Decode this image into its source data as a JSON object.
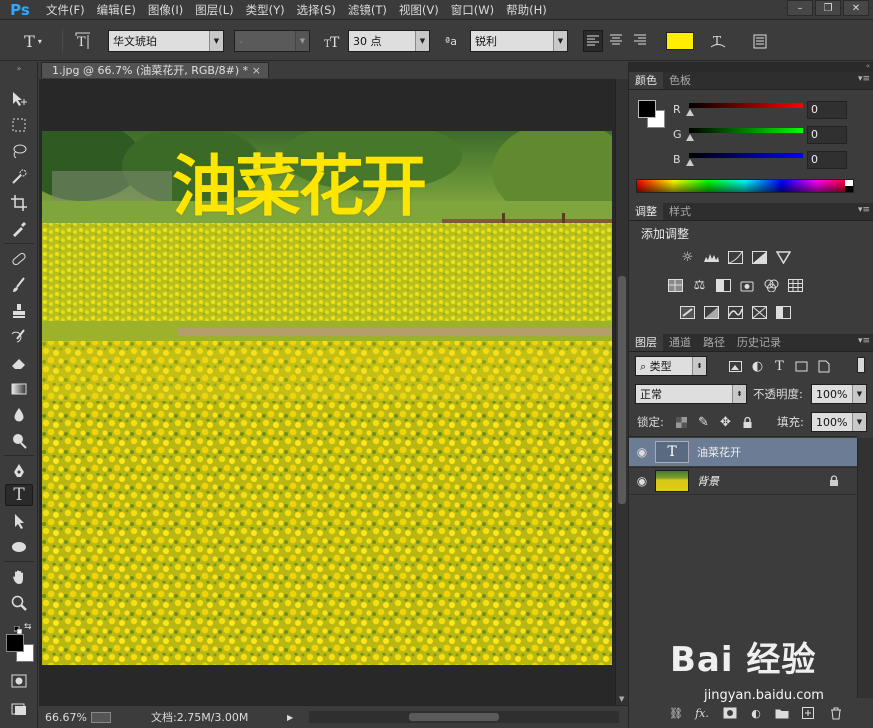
{
  "app": {
    "logo": "Ps"
  },
  "menu": [
    "文件(F)",
    "编辑(E)",
    "图像(I)",
    "图层(L)",
    "类型(Y)",
    "选择(S)",
    "滤镜(T)",
    "视图(V)",
    "窗口(W)",
    "帮助(H)"
  ],
  "window_controls": {
    "minimize": "–",
    "restore": "❐",
    "close": "✕"
  },
  "options": {
    "font_family": "华文琥珀",
    "font_style": "-",
    "font_size": "30 点",
    "aa_label": "ªa",
    "antialias": "锐利",
    "text_color": "#ffee00"
  },
  "document": {
    "tab_title": "1.jpg @ 66.7% (油菜花开, RGB/8#) *",
    "close": "×",
    "overlay_text": "油菜花开",
    "overlay_color": "#ffe600"
  },
  "status": {
    "zoom": "66.67%",
    "doc_info": "文档:2.75M/3.00M",
    "arrow": "▶"
  },
  "panels": {
    "color": {
      "tabs": [
        "颜色",
        "色板"
      ],
      "r_label": "R",
      "g_label": "G",
      "b_label": "B",
      "r_value": "0",
      "g_value": "0",
      "b_value": "0"
    },
    "adjustments": {
      "tabs": [
        "调整",
        "样式"
      ],
      "heading": "添加调整"
    },
    "layers": {
      "tabs": [
        "图层",
        "通道",
        "路径",
        "历史记录"
      ],
      "filter_type": "类型",
      "blend_mode": "正常",
      "opacity_label": "不透明度:",
      "opacity_value": "100%",
      "lock_label": "锁定:",
      "fill_label": "填充:",
      "fill_value": "100%",
      "items": [
        {
          "name": "油菜花开",
          "kind": "T",
          "selected": true
        },
        {
          "name": "背景",
          "kind": "image",
          "selected": false
        }
      ],
      "bottom_icons": [
        "link-icon",
        "fx-icon",
        "mask-icon",
        "adjustment-icon",
        "folder-icon",
        "new-layer-icon",
        "trash-icon"
      ],
      "fx_label": "fx."
    }
  },
  "watermark": {
    "main": "Bai 经验",
    "sub": "jingyan.baidu.com"
  },
  "colors": {
    "foreground": "#000000",
    "background": "#ffffff",
    "selection": "#6b7c94"
  }
}
